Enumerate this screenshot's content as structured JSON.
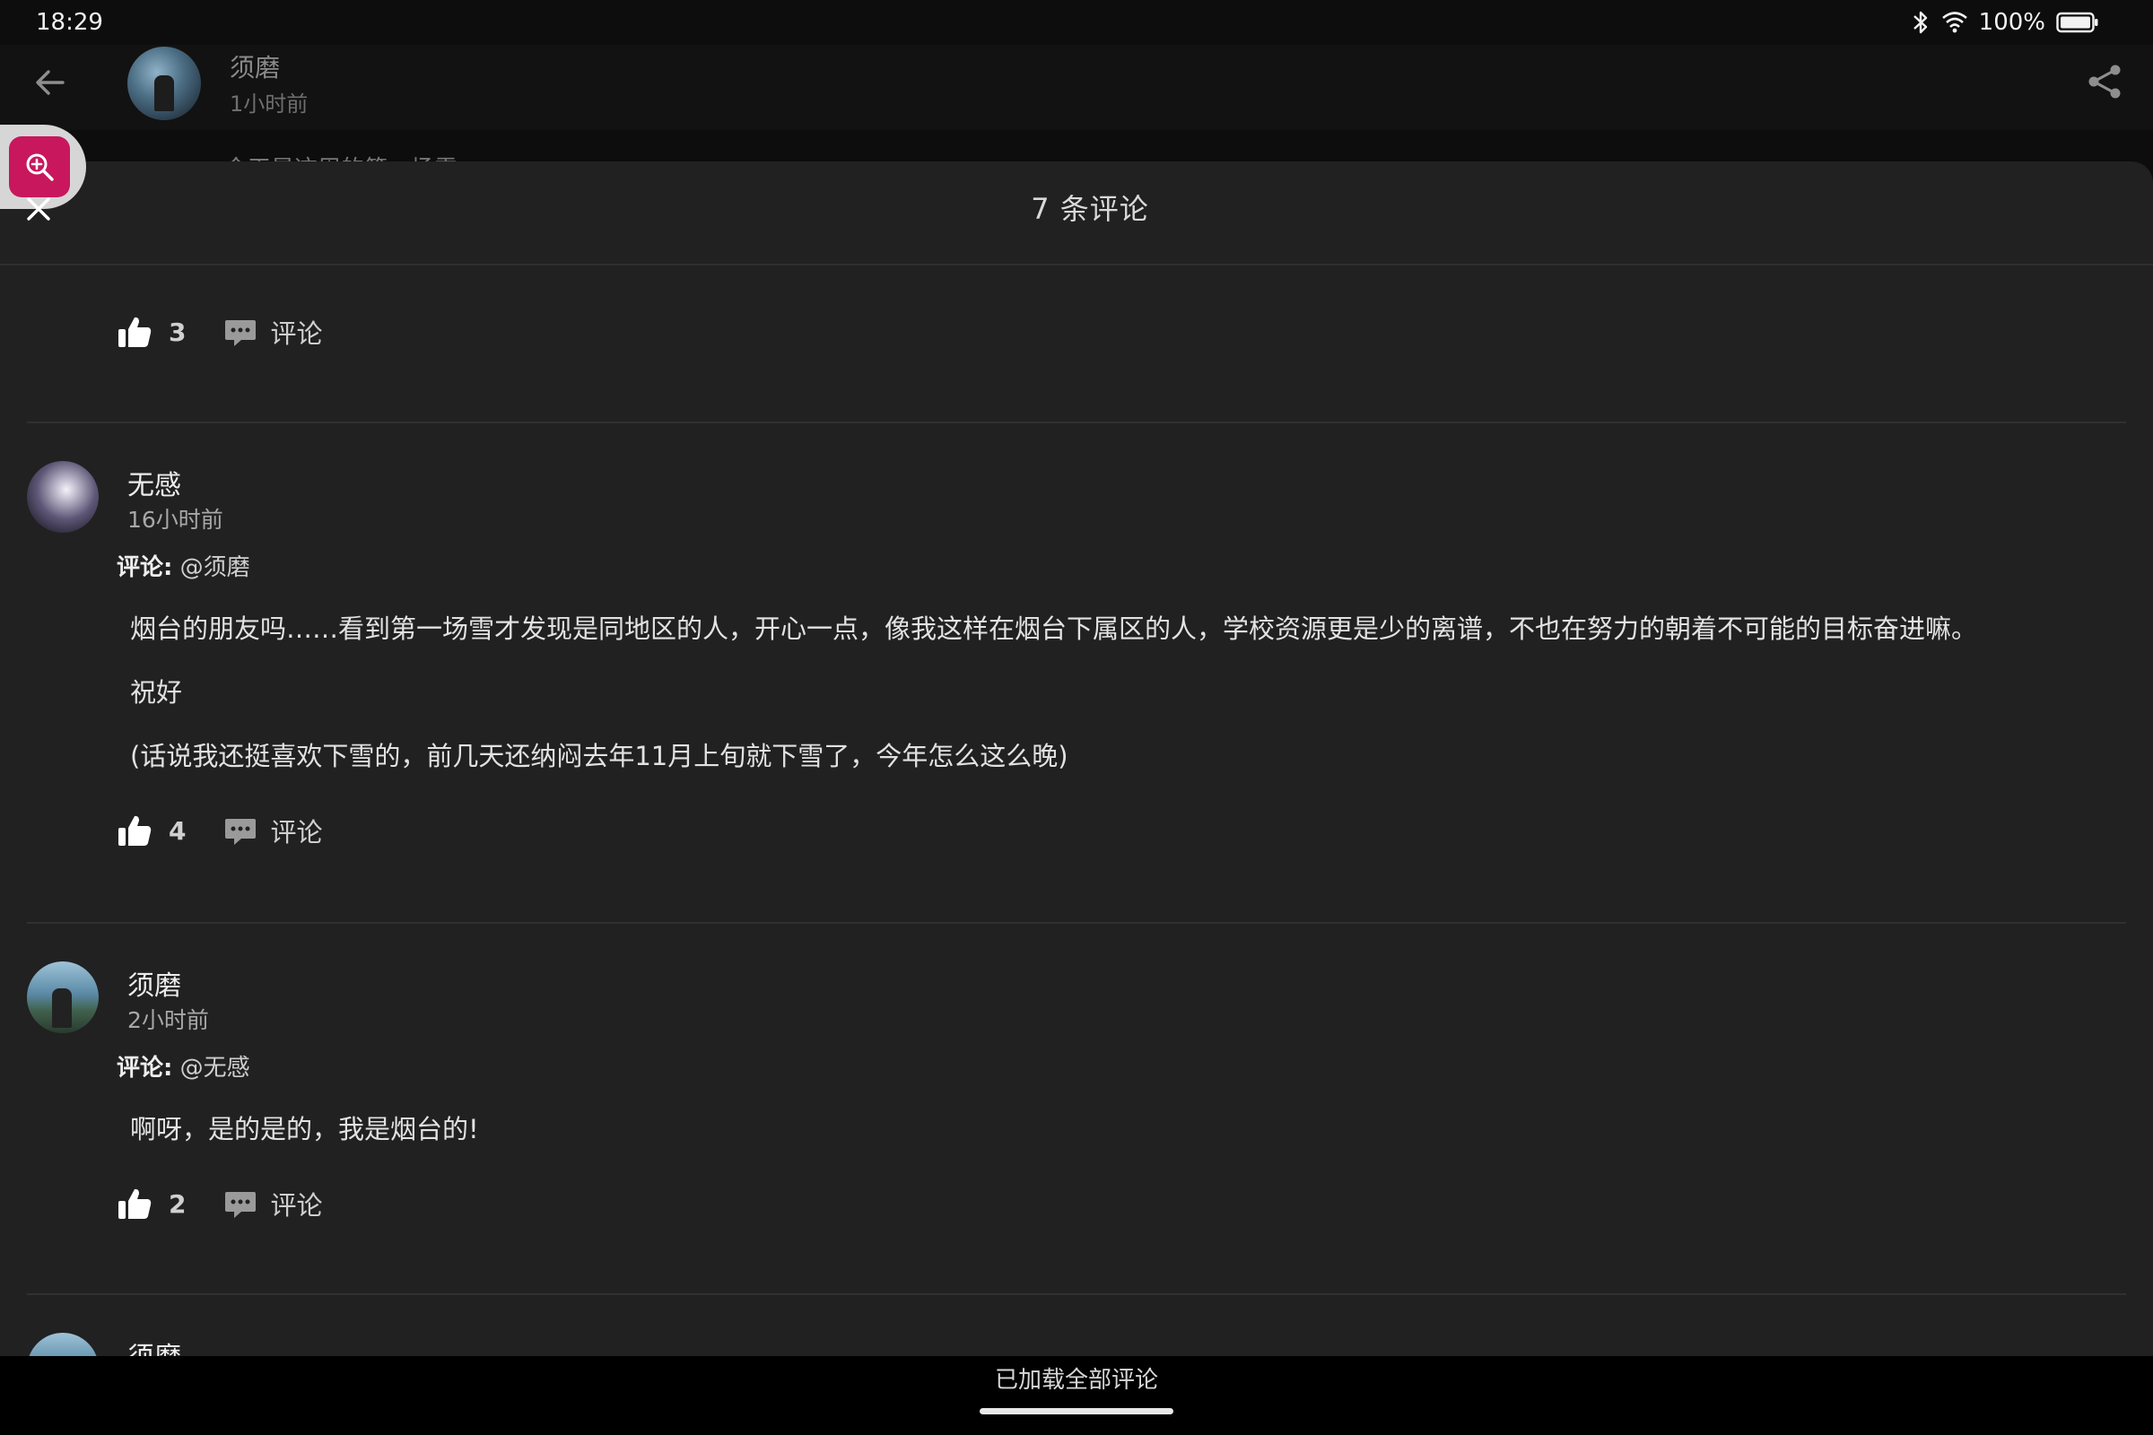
{
  "status_bar": {
    "time": "18:29",
    "battery": "100%",
    "icons": [
      "bluetooth-icon",
      "wifi-icon",
      "battery-icon"
    ]
  },
  "post_header": {
    "author": "须磨",
    "time": "1小时前",
    "peek_text": "今天是这周的第一场雪"
  },
  "sheet": {
    "title": "7 条评论"
  },
  "top_actions": {
    "likes": "3",
    "reply_label": "评论"
  },
  "comments": [
    {
      "author": "无感",
      "time": "16小时前",
      "target_prefix": "评论:",
      "target": "@须磨",
      "paragraphs": [
        "烟台的朋友吗……看到第一场雪才发现是同地区的人，开心一点，像我这样在烟台下属区的人，学校资源更是少的离谱，不也在努力的朝着不可能的目标奋进嘛。",
        "祝好",
        "(话说我还挺喜欢下雪的，前几天还纳闷去年11月上旬就下雪了，今年怎么这么晚)"
      ],
      "likes": "4",
      "reply_label": "评论"
    },
    {
      "author": "须磨",
      "time": "2小时前",
      "target_prefix": "评论:",
      "target": "@无感",
      "paragraphs": [
        "啊呀，是的是的，我是烟台的!"
      ],
      "likes": "2",
      "reply_label": "评论"
    },
    {
      "author": "须磨"
    }
  ],
  "footer": {
    "loaded_text": "已加载全部评论"
  },
  "colors": {
    "background": "#0d0d0d",
    "sheet": "#212121",
    "accent": "#c8175d"
  }
}
